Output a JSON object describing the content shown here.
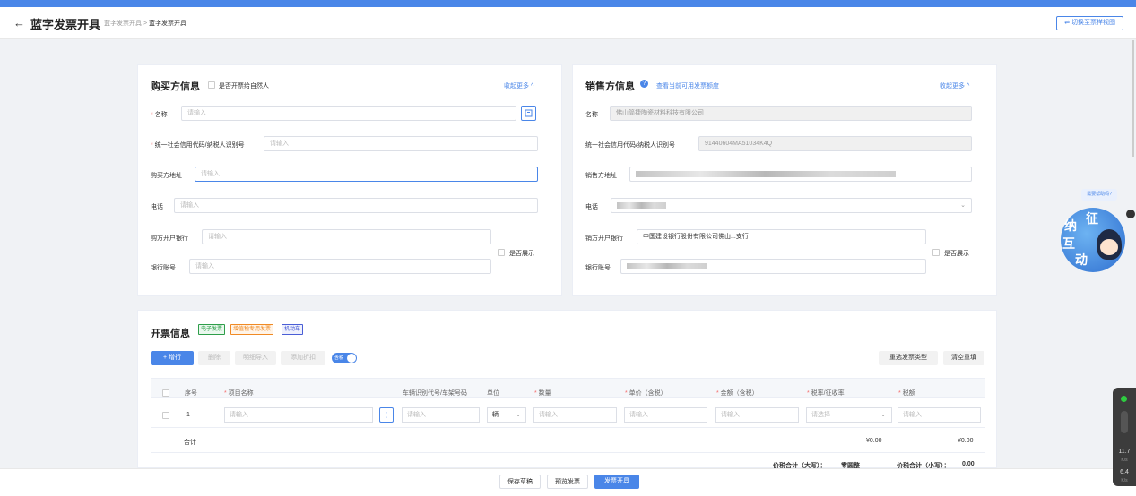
{
  "header": {
    "back": "←",
    "title": "蓝字发票开具",
    "crumb_parent": "蓝字发票开具",
    "crumb_sep": ">",
    "crumb_current": "蓝字发票开具",
    "switch_label": "⇌ 切换至票样视图"
  },
  "buyer": {
    "title": "购买方信息",
    "natural_person": "是否开票给自然人",
    "collapse": "收起更多 ^",
    "name_label": "名称",
    "tax_label": "统一社会信用代码/纳税人识别号",
    "address_label": "购买方地址",
    "phone_label": "电话",
    "bank_label": "购方开户银行",
    "account_label": "银行账号",
    "show_label": "是否展示",
    "placeholder": "请输入"
  },
  "seller": {
    "title": "销售方信息",
    "quota_link": "查看当前可用发票额度",
    "collapse": "收起更多 ^",
    "name_label": "名称",
    "name_value": "佛山简捷陶瓷材料科技有限公司",
    "tax_label": "统一社会信用代码/纳税人识别号",
    "tax_value": "91440604MA51034K4Q",
    "address_label": "销售方地址",
    "phone_label": "电话",
    "bank_label": "销方开户银行",
    "bank_value": "中国建设银行股份有限公司佛山...支行",
    "account_label": "银行账号",
    "show_label": "是否展示"
  },
  "invoice": {
    "title": "开票信息",
    "tags": [
      "电子发票",
      "增值税专用发票",
      "机动车"
    ],
    "add_row": "+ 增行",
    "delete": "删除",
    "detail_import": "明细导入",
    "add_discount": "添加折扣",
    "tax_included": "含税",
    "reselect": "重选发票类型",
    "clear": "清空重填",
    "columns": [
      "序号",
      "项目名称",
      "车辆识别代号/车架号码",
      "单位",
      "数量",
      "单价（含税）",
      "金额（含税）",
      "税率/征收率",
      "税额"
    ],
    "row_index": "1",
    "unit_value": "辆",
    "placeholder": "请输入",
    "select_placeholder": "请选择",
    "total_label": "合计",
    "total_amount": "¥0.00",
    "total_tax": "¥0.00",
    "total_upper_label": "价税合计（大写）：",
    "total_upper_value": "零圆整",
    "total_lower_label": "价税合计（小写）：",
    "total_lower_value": "0.00"
  },
  "footer": {
    "save_draft": "保存草稿",
    "preview": "预览发票",
    "issue": "发票开具"
  },
  "assistant": {
    "bubble": "需要帮助吗?",
    "line1": "征",
    "line2": "纳",
    "line3": "互",
    "line4": "动"
  },
  "speed": {
    "up": "11.7",
    "up_unit": "K/s",
    "down": "6.4",
    "down_unit": "K/s"
  }
}
